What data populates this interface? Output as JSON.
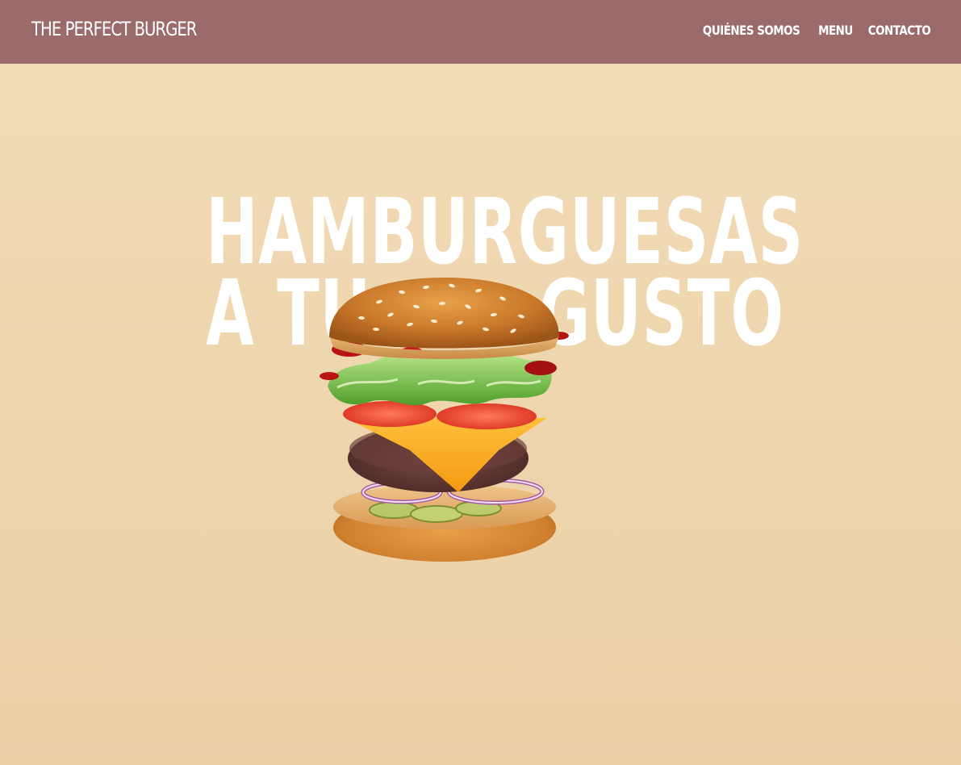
{
  "nav": {
    "brand": "THE PERFECT BURGER",
    "links": [
      "QUIÉNES SOMOS",
      "MENU",
      "CONTACTO"
    ]
  },
  "hero": {
    "line1": "HAMBURGUESAS",
    "line2_left": "A TU",
    "line2_right": "GUSTO",
    "image": "burger-image"
  },
  "colors": {
    "navbar": "#9b6b6c",
    "background": "#f0d9b3",
    "text": "#ffffff"
  }
}
